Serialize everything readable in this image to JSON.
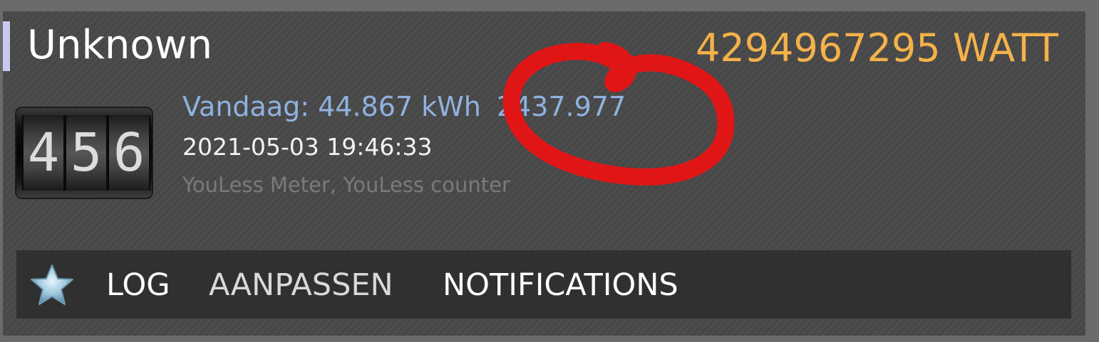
{
  "device": {
    "name": "Unknown",
    "power": "4294967295 WATT",
    "today": "Vandaag: 44.867 kWh",
    "total": "2437.977",
    "last_update": "2021-05-03 19:46:33",
    "type": "YouLess Meter, YouLess counter",
    "counter_digits": [
      "4",
      "5",
      "6"
    ]
  },
  "toolbar": {
    "log_label": "LOG",
    "edit_label": "AANPASSEN",
    "notifications_label": "NOTIFICATIONS"
  },
  "icons": {
    "favorite": "star-icon",
    "device": "counter-icon"
  },
  "colors": {
    "accent_power": "#f4b24a",
    "info_blue": "#8fb2e0",
    "annotation_red": "#e01616",
    "widget_bg": "#474747",
    "toolbar_bg": "#303030"
  }
}
